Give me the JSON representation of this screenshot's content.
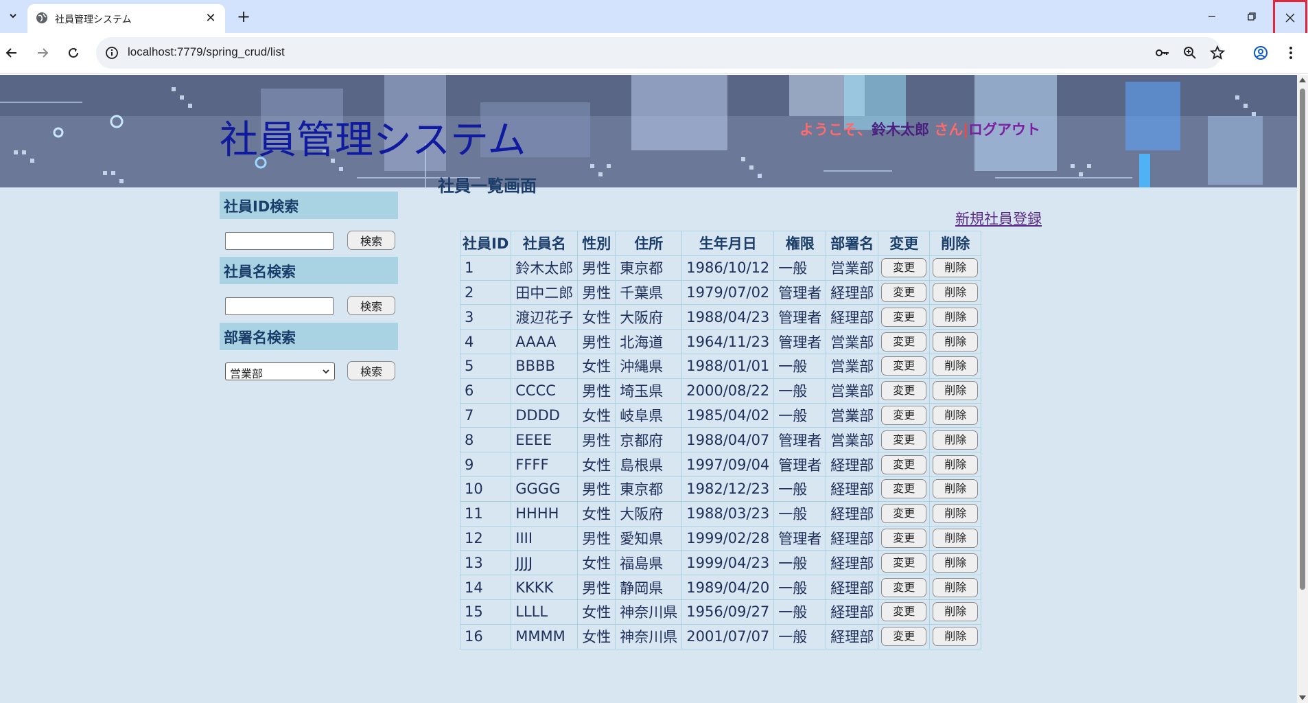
{
  "browser": {
    "tab_title": "社員管理システム",
    "url": "localhost:7779/spring_crud/list"
  },
  "header": {
    "site_title": "社員管理システム",
    "welcome_prefix": "ようこそ、",
    "user_name": "鈴木太郎",
    "welcome_suffix": " さん",
    "separator": "|",
    "logout": "ログアウト"
  },
  "sidebar": {
    "id_search": {
      "heading": "社員ID検索",
      "button": "検索",
      "value": ""
    },
    "name_search": {
      "heading": "社員名検索",
      "button": "検索",
      "value": ""
    },
    "dept_search": {
      "heading": "部署名検索",
      "button": "検索",
      "selected": "営業部"
    }
  },
  "main": {
    "heading": "社員一覧画面",
    "new_link": "新規社員登録",
    "columns": [
      "社員ID",
      "社員名",
      "性別",
      "住所",
      "生年月日",
      "権限",
      "部署名",
      "変更",
      "削除"
    ],
    "edit_label": "変更",
    "delete_label": "削除",
    "rows": [
      [
        "1",
        "鈴木太郎",
        "男性",
        "東京都",
        "1986/10/12",
        "一般",
        "営業部"
      ],
      [
        "2",
        "田中二郎",
        "男性",
        "千葉県",
        "1979/07/02",
        "管理者",
        "経理部"
      ],
      [
        "3",
        "渡辺花子",
        "女性",
        "大阪府",
        "1988/04/23",
        "管理者",
        "経理部"
      ],
      [
        "4",
        "AAAA",
        "男性",
        "北海道",
        "1964/11/23",
        "管理者",
        "営業部"
      ],
      [
        "5",
        "BBBB",
        "女性",
        "沖縄県",
        "1988/01/01",
        "一般",
        "営業部"
      ],
      [
        "6",
        "CCCC",
        "男性",
        "埼玉県",
        "2000/08/22",
        "一般",
        "営業部"
      ],
      [
        "7",
        "DDDD",
        "女性",
        "岐阜県",
        "1985/04/02",
        "一般",
        "営業部"
      ],
      [
        "8",
        "EEEE",
        "男性",
        "京都府",
        "1988/04/07",
        "管理者",
        "営業部"
      ],
      [
        "9",
        "FFFF",
        "女性",
        "島根県",
        "1997/09/04",
        "管理者",
        "経理部"
      ],
      [
        "10",
        "GGGG",
        "男性",
        "東京都",
        "1982/12/23",
        "一般",
        "経理部"
      ],
      [
        "11",
        "HHHH",
        "女性",
        "大阪府",
        "1988/03/23",
        "一般",
        "経理部"
      ],
      [
        "12",
        "IIII",
        "男性",
        "愛知県",
        "1999/02/28",
        "管理者",
        "経理部"
      ],
      [
        "13",
        "JJJJ",
        "女性",
        "福島県",
        "1999/04/23",
        "一般",
        "経理部"
      ],
      [
        "14",
        "KKKK",
        "男性",
        "静岡県",
        "1989/04/20",
        "一般",
        "経理部"
      ],
      [
        "15",
        "LLLL",
        "女性",
        "神奈川県",
        "1956/09/27",
        "一般",
        "経理部"
      ],
      [
        "16",
        "MMMM",
        "女性",
        "神奈川県",
        "2001/07/07",
        "一般",
        "経理部"
      ]
    ]
  },
  "icons": {
    "tab_list": "chevron-down-icon",
    "favicon": "globe-icon",
    "back": "arrow-left-icon",
    "forward": "arrow-right-icon",
    "reload": "reload-icon",
    "site_info": "info-icon",
    "password": "key-icon",
    "zoom": "zoom-icon",
    "bookmark": "star-icon",
    "profile": "profile-icon",
    "menu": "more-vert-icon"
  },
  "colors": {
    "tabbar": "#d3e3fd",
    "page_bg": "#d8e6f2",
    "sidebar_heading_bg": "#a9d3e3",
    "site_title": "#0f1a9e",
    "welcome_text": "#ff6b6b",
    "close_highlight": "#e0263a"
  }
}
